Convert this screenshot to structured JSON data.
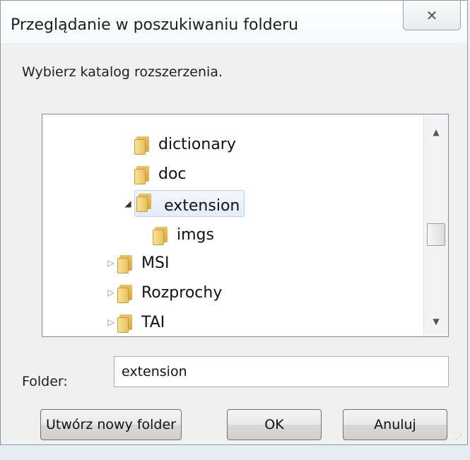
{
  "dialog": {
    "title": "Przeglądanie w poszukiwaniu folderu",
    "close_glyph": "✕",
    "prompt": "Wybierz katalog rozszerzenia."
  },
  "tree": {
    "items": [
      {
        "label": "dictionary",
        "expander": "",
        "selected": false
      },
      {
        "label": "doc",
        "expander": "",
        "selected": false
      },
      {
        "label": "extension",
        "expander": "◢",
        "selected": true
      },
      {
        "label": "imgs",
        "expander": "",
        "selected": false
      },
      {
        "label": "MSI",
        "expander": "▷",
        "selected": false
      },
      {
        "label": "Rozprochy",
        "expander": "▷",
        "selected": false
      },
      {
        "label": "TAI",
        "expander": "▷",
        "selected": false
      }
    ],
    "scroll_up": "▲",
    "scroll_down": "▼"
  },
  "folder": {
    "label": "Folder:",
    "value": "extension"
  },
  "buttons": {
    "new_folder": "Utwórz nowy folder",
    "ok": "OK",
    "cancel": "Anuluj"
  },
  "icons": {
    "folder": "folder-icon",
    "close": "close-icon"
  }
}
